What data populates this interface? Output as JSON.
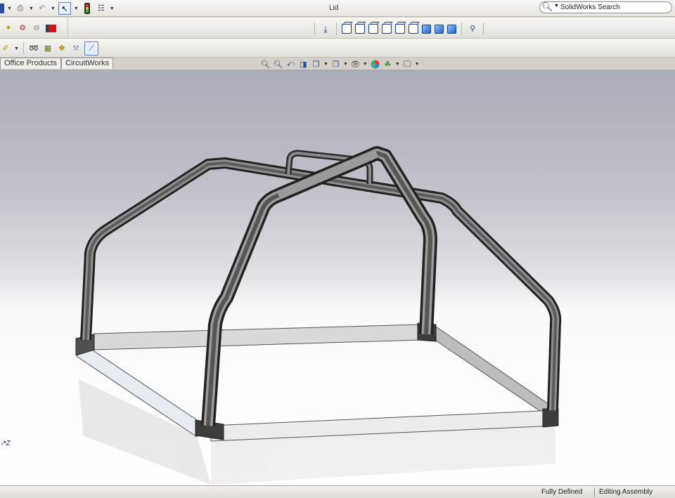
{
  "window": {
    "title": "Lid"
  },
  "search": {
    "placeholder": "SolidWorks Search"
  },
  "addin_tabs": [
    "Office Products",
    "CircuitWorks"
  ],
  "status": {
    "defined": "Fully Defined",
    "mode": "Editing Assembly"
  },
  "triad": {
    "axis_label": "Z"
  },
  "icons": {
    "titlebar": [
      "save-icon",
      "print-icon",
      "undo-icon",
      "select-arrow-icon",
      "traffic-light-icon",
      "options-icon"
    ],
    "toolbar2_left": [
      "insert-components-icon",
      "mate-icon",
      "check-icon",
      "red-square-icon"
    ],
    "toolbar2_center": [
      "normal-to-icon",
      "view-front-icon",
      "view-back-icon",
      "view-left-icon",
      "view-right-icon",
      "view-top-icon",
      "view-bottom-icon",
      "view-iso-icon",
      "view-trimetric-icon",
      "view-dimetric-icon",
      "link-views-icon"
    ],
    "toolbar3": [
      "sketch-dropdown-icon",
      "mirror-icon",
      "assembly-features-icon",
      "move-component-icon",
      "smart-fasteners-icon",
      "selected-tool-icon"
    ],
    "heads_up": [
      "zoom-to-fit-icon",
      "zoom-area-icon",
      "previous-view-icon",
      "section-view-icon",
      "view-orientation-icon",
      "display-style-icon",
      "hide-show-icon",
      "edit-appearance-icon",
      "apply-scene-icon",
      "view-settings-icon"
    ]
  },
  "colors": {
    "frame": "#4b4b4b",
    "frame_highlight": "#9a9a9a",
    "base": "#d9d9d9"
  }
}
